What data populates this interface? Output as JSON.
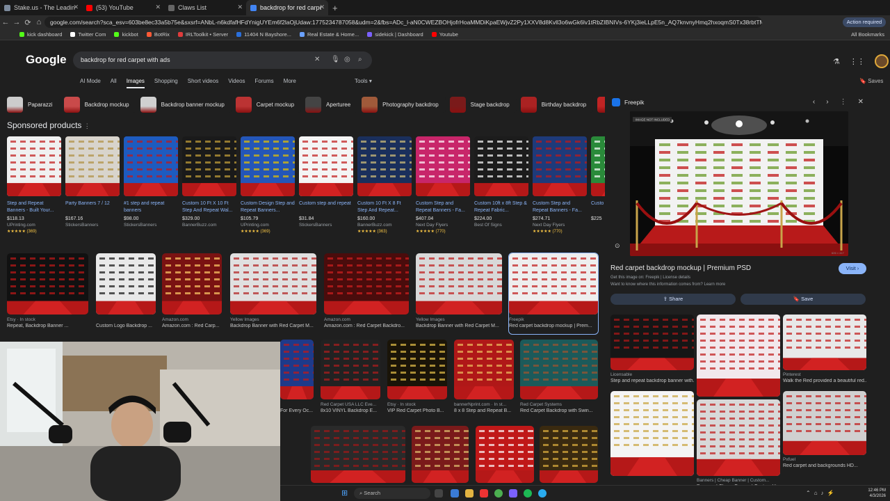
{
  "browser": {
    "tabs": [
      {
        "title": "Stake.us - The Leading Social C",
        "color": "#7c8a9c"
      },
      {
        "title": "(53) YouTube",
        "color": "#ff0000"
      },
      {
        "title": "Claws List",
        "color": "#666666"
      },
      {
        "title": "backdrop for red carpet with a",
        "color": "#4285f4"
      }
    ],
    "url": "google.com/search?sca_esv=603be8ec33a5b75e&sxsrf=ANbL-n6kdfafHFdYnigUYEm6f2laOjUdaw:1775234787058&udm=2&fbs=ADc_l-aN0CWEZBOHjofrHoaMMDiKpaEWjvZ2Py1XXV8d8Kvll3o6wGk6lv1tRbZIBNIVs-6YKj3ieLLpE5n_AQ7knvnyHmq2hxoqmS0Tx38rbtTMokatCu4UnrJzhU7BOXw7Cjzpgexdl",
    "action_required": "Action required",
    "bookmarks": [
      {
        "label": "kick dashboard",
        "color": "#53fc18"
      },
      {
        "label": "Twitter Com",
        "color": "#ffffff"
      },
      {
        "label": "kickbot",
        "color": "#53fc18"
      },
      {
        "label": "BotRix",
        "color": "#ff5a36"
      },
      {
        "label": "IRLToolkit • Server",
        "color": "#e03c3c"
      },
      {
        "label": "11404 N Bayshore...",
        "color": "#2a6fdb"
      },
      {
        "label": "Real Estate & Home...",
        "color": "#6aa1ff"
      },
      {
        "label": "sidekick | Dashboard",
        "color": "#7b61ff"
      },
      {
        "label": "Youtube",
        "color": "#ff0000"
      }
    ],
    "all_bookmarks": "All Bookmarks"
  },
  "google": {
    "logo": "Google",
    "query": "backdrop for red carpet with ads",
    "nav": [
      "AI Mode",
      "All",
      "Images",
      "Shopping",
      "Short videos",
      "Videos",
      "Forums",
      "More"
    ],
    "active_nav": "Images",
    "tools": "Tools",
    "saves": "Saves",
    "chips": [
      {
        "label": "Paparazzi",
        "color": "#cccccc"
      },
      {
        "label": "Backdrop mockup",
        "color": "#c94a4a"
      },
      {
        "label": "Backdrop banner mockup",
        "color": "#d0d0d0"
      },
      {
        "label": "Carpet mockup",
        "color": "#b33"
      },
      {
        "label": "Aperturee",
        "color": "#444"
      },
      {
        "label": "Photography backdrop",
        "color": "#a05a3a"
      },
      {
        "label": "Stage backdrop",
        "color": "#7a1a1a"
      },
      {
        "label": "Birthday backdrop",
        "color": "#aa2222"
      },
      {
        "label": "Event",
        "color": "#c02424"
      }
    ]
  },
  "sponsored": {
    "heading": "Sponsored products",
    "items": [
      {
        "title": "Step and Repeat Banners - Built Your...",
        "price": "$118.13",
        "seller": "UPrinting.com",
        "rating": "★★★★★ (369)",
        "bg": "#f0f0f0",
        "accent": "#c01818"
      },
      {
        "title": "Party Banners 7 / 12",
        "price": "$167.16",
        "seller": "StickersBanners",
        "rating": "",
        "bg": "#d8d4cc",
        "accent": "#b09040"
      },
      {
        "title": "#1 step and repeat banners",
        "price": "$98.00",
        "seller": "StickersBanners",
        "rating": "",
        "bg": "#1e5bbf",
        "accent": "#c01818"
      },
      {
        "title": "Custom 10 Ft X 10 Ft Step And Repeat Wal...",
        "price": "$329.00",
        "seller": "BannerBuzz.com",
        "rating": "",
        "bg": "#1a1a1a",
        "accent": "#c9a43a"
      },
      {
        "title": "Custom Design Step and Repeat Banners...",
        "price": "$105.79",
        "seller": "UPrinting.com",
        "rating": "★★★★★ (369)",
        "bg": "#2456b8",
        "accent": "#e5c200"
      },
      {
        "title": "Custom step and repeat",
        "price": "$31.84",
        "seller": "StickersBanners",
        "rating": "",
        "bg": "#f4f4f4",
        "accent": "#c01818"
      },
      {
        "title": "Custom 10 Ft X 8 Ft Step And Repeat...",
        "price": "$160.00",
        "seller": "BannerBuzz.com",
        "rating": "★★★★★ (363)",
        "bg": "#1a2f5c",
        "accent": "#d5c27a"
      },
      {
        "title": "Custom Step and Repeat Banners - Fa...",
        "price": "$407.04",
        "seller": "Next Day Flyers",
        "rating": "★★★★★ (770)",
        "bg": "#c8266a",
        "accent": "#ffffff"
      },
      {
        "title": "Custom 10ft x 8ft Step & Repeat Fabric...",
        "price": "$224.00",
        "seller": "Best Of Signs",
        "rating": "",
        "bg": "#1c1c1c",
        "accent": "#ffffff"
      },
      {
        "title": "Custom Step and Repeat Banners - Fa...",
        "price": "$274.71",
        "seller": "Next Day Flyers",
        "rating": "★★★★★ (770)",
        "bg": "#1e3a7a",
        "accent": "#c01818"
      },
      {
        "title": "Custo And R",
        "price": "$225",
        "seller": "",
        "rating": "",
        "bg": "#2a8a3a",
        "accent": "#ffffff"
      }
    ]
  },
  "grid_row1": [
    {
      "src": "Etsy · In stock",
      "cap": "Repeat, Backdrop Banner ...",
      "bg": "#111111",
      "accent": "#c01818"
    },
    {
      "src": "",
      "cap": "Custom Logo Backdrop ...",
      "bg": "#e8e8e8",
      "accent": "#111111"
    },
    {
      "src": "Amazon.com",
      "cap": "Amazon.com : Red Carp...",
      "bg": "#7a1212",
      "accent": "#ffcc66"
    },
    {
      "src": "Yellow Images",
      "cap": "Backdrop Banner with Red Carpet M...",
      "bg": "#e0e0e0",
      "accent": "#b01c1c"
    },
    {
      "src": "Amazon.com",
      "cap": "Amazon.com : Red Carpet Backdro...",
      "bg": "#4a0c0c",
      "accent": "#d02020"
    },
    {
      "src": "Yellow Images",
      "cap": "Backdrop Banner with Red Carpet M...",
      "bg": "#d8d8d8",
      "accent": "#c01818"
    },
    {
      "src": "Freepik",
      "cap": "Red carpet backdrop mockup | Prem...",
      "bg": "#eeeeee",
      "accent": "#c01818"
    }
  ],
  "grid_row2": [
    {
      "src": "",
      "cap": "For Every Oc...",
      "bg": "#1e3a8a",
      "accent": "#c01818"
    },
    {
      "src": "Red Carpet USA LLC Eve...",
      "cap": "8x10 VINYL Backdrop E...",
      "bg": "#222222",
      "accent": "#b01c1c"
    },
    {
      "src": "Etsy · In stock",
      "cap": "VIP Red Carpet Photo B...",
      "bg": "#1a1408",
      "accent": "#e8c24a"
    },
    {
      "src": "bannerNprint.com · In st...",
      "cap": "8 x 8 Step and Repeat B...",
      "bg": "#b01818",
      "accent": "#f0c060"
    },
    {
      "src": "Red Carpet Systems",
      "cap": "Red Carpet Backdrop with Swin...",
      "bg": "#1c5a5a",
      "accent": "#a0522d"
    }
  ],
  "grid_row3": [
    {
      "bg": "#2a2a2a",
      "accent": "#a01818"
    },
    {
      "bg": "#7a1a1a",
      "accent": "#e0c070"
    },
    {
      "bg": "#c01818",
      "accent": "#ffffff"
    },
    {
      "bg": "#3a2a10",
      "accent": "#e0b040"
    }
  ],
  "panel": {
    "source": "Freepik",
    "badge": "IMAGE NOT INCLUDED",
    "dims": "626 × 417",
    "title": "Red carpet backdrop mockup | Premium PSD",
    "visit": "Visit",
    "get_image": "Get this image on: Freepik | License details",
    "why": "Want to know where this information comes from? Learn more",
    "share": "Share",
    "save": "Save",
    "related": [
      {
        "src": "Licensable",
        "cap": "Step and repeat backdrop banner with...",
        "bg": "#161616",
        "accent": "#b01818"
      },
      {
        "src": "",
        "cap": "",
        "bg": "#f2e8ec",
        "accent": "#c01818"
      },
      {
        "src": "Pinterest",
        "cap": "Walk the Red provided a beautiful red...",
        "bg": "#e8e8e8",
        "accent": "#c01818"
      },
      {
        "src": "",
        "cap": "",
        "bg": "#f4f4f4",
        "accent": "#c8a23a"
      },
      {
        "src": "Banners | Cheap Banner | Custom...",
        "cap": "Banners | Cheap Banner | Custom Vinyl...",
        "bg": "#d8d8d8",
        "accent": "#c01818"
      },
      {
        "src": "Pxfuel",
        "cap": "Red carpet and backgrounds HD...",
        "bg": "#d0d0d0",
        "accent": "#c01818"
      }
    ]
  },
  "taskbar": {
    "search": "Search",
    "time": "12:46 PM",
    "date": "4/3/2026"
  }
}
